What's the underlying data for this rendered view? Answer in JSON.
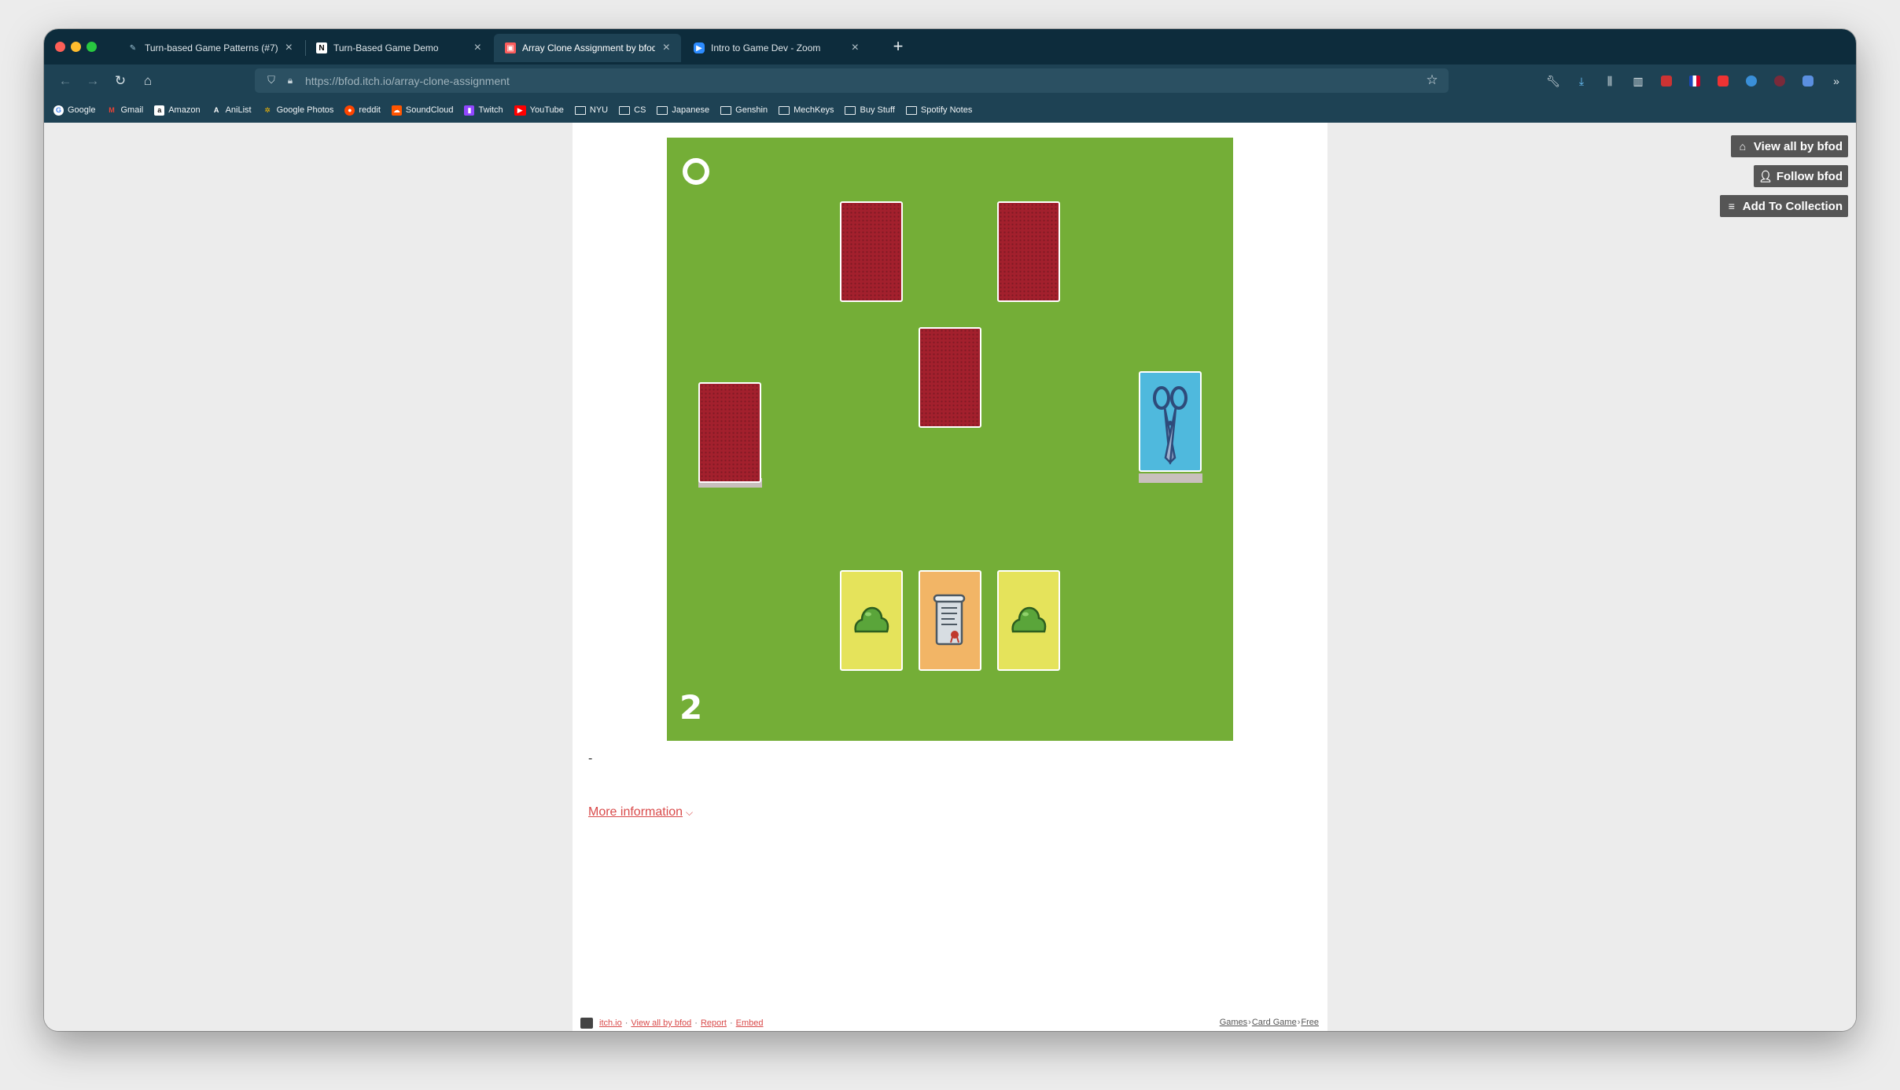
{
  "browser": {
    "tabs": [
      {
        "label": "Turn-based Game Patterns (#7)",
        "icon": "pencil-icon"
      },
      {
        "label": "Turn-Based Game Demo",
        "icon": "notion-icon"
      },
      {
        "label": "Array Clone Assignment by bfod",
        "icon": "itch-icon",
        "active": true
      },
      {
        "label": "Intro to Game Dev - Zoom",
        "icon": "zoom-icon"
      }
    ],
    "url": "https://bfod.itch.io/array-clone-assignment",
    "bookmarks": [
      {
        "label": "Google",
        "icon": "google-icon"
      },
      {
        "label": "Gmail",
        "icon": "gmail-icon"
      },
      {
        "label": "Amazon",
        "icon": "amazon-icon"
      },
      {
        "label": "AniList",
        "icon": "anilist-icon"
      },
      {
        "label": "Google Photos",
        "icon": "google-photos-icon"
      },
      {
        "label": "reddit",
        "icon": "reddit-icon"
      },
      {
        "label": "SoundCloud",
        "icon": "soundcloud-icon"
      },
      {
        "label": "Twitch",
        "icon": "twitch-icon"
      },
      {
        "label": "YouTube",
        "icon": "youtube-icon"
      },
      {
        "label": "NYU",
        "icon": "folder-icon"
      },
      {
        "label": "CS",
        "icon": "folder-icon"
      },
      {
        "label": "Japanese",
        "icon": "folder-icon"
      },
      {
        "label": "Genshin",
        "icon": "folder-icon"
      },
      {
        "label": "MechKeys",
        "icon": "folder-icon"
      },
      {
        "label": "Buy Stuff",
        "icon": "folder-icon"
      },
      {
        "label": "Spotify Notes",
        "icon": "folder-icon"
      }
    ]
  },
  "game": {
    "turn_number": "2",
    "background_color": "#74ae37",
    "opponent_cards": [
      "card-back",
      "card-back"
    ],
    "center_card": "card-back",
    "left_deck_top": "card-back",
    "right_deck_top": "scissors",
    "hand_cards": [
      "slime",
      "scroll",
      "slime"
    ]
  },
  "page": {
    "description": "-",
    "more_info_label": "More information"
  },
  "sidebar": {
    "view_all_label": "View all by bfod",
    "follow_label": "Follow bfod",
    "collection_label": "Add To Collection"
  },
  "footer": {
    "site_link": "itch.io",
    "view_all_link": "View all by bfod",
    "report_link": "Report",
    "embed_link": "Embed",
    "bullet": "·",
    "crumb_separator": "›",
    "crumbs": [
      "Games",
      "Card Game",
      "Free"
    ]
  },
  "colors": {
    "chrome_dark": "#0d2c3c",
    "chrome": "#1e4254",
    "link_red": "#d94a4a",
    "card_back_red": "#a3202d"
  }
}
